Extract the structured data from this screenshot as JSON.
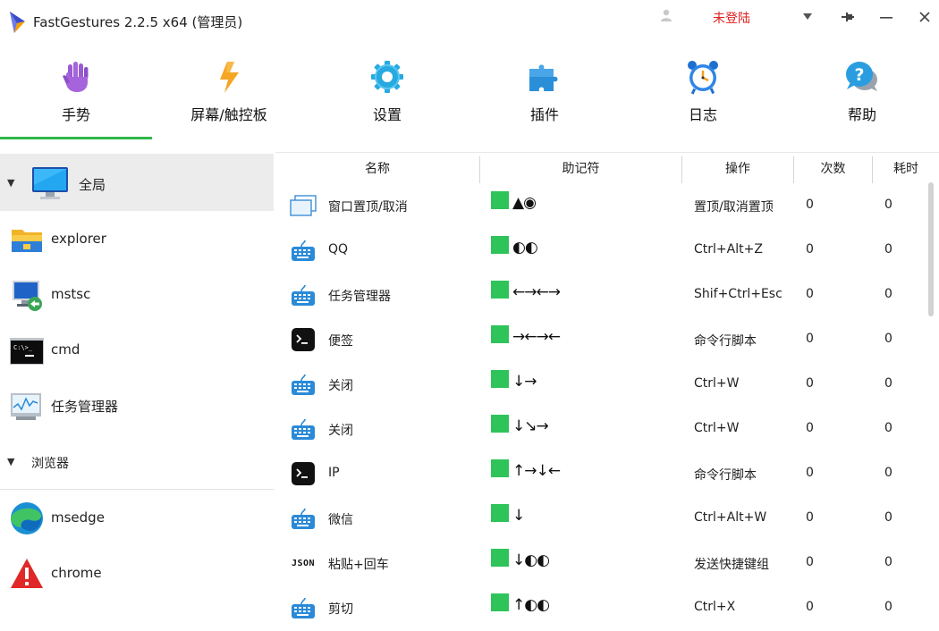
{
  "window": {
    "title": "FastGestures 2.2.5 x64 (管理员)",
    "login_status": "未登陆"
  },
  "toolbar": {
    "items": [
      {
        "label": "手势",
        "icon": "hand-icon"
      },
      {
        "label": "屏幕/触控板",
        "icon": "lightning-icon"
      },
      {
        "label": "设置",
        "icon": "gear-icon"
      },
      {
        "label": "插件",
        "icon": "puzzle-icon"
      },
      {
        "label": "日志",
        "icon": "alarm-clock-icon"
      },
      {
        "label": "帮助",
        "icon": "help-icon"
      }
    ],
    "active_index": 0
  },
  "sidebar": {
    "global": {
      "label": "全局",
      "icon": "monitor-icon"
    },
    "apps": [
      {
        "name": "explorer",
        "icon": "folder-icon"
      },
      {
        "name": "mstsc",
        "icon": "remote-desktop-icon"
      },
      {
        "name": "cmd",
        "icon": "terminal-icon"
      },
      {
        "name": "任务管理器",
        "icon": "task-manager-icon"
      }
    ],
    "browser_group": {
      "label": "浏览器"
    },
    "browser_apps": [
      {
        "name": "msedge",
        "icon": "edge-icon"
      },
      {
        "name": "chrome",
        "icon": "warning-icon"
      }
    ]
  },
  "table": {
    "columns": [
      "名称",
      "助记符",
      "操作",
      "次数",
      "耗时"
    ],
    "rows": [
      {
        "icon": "window-icon",
        "name": "窗口置顶/取消",
        "mnemonic": "▲◉",
        "action": "置顶/取消置顶",
        "count": "0",
        "time": "0"
      },
      {
        "icon": "keyboard-icon",
        "name": "QQ",
        "mnemonic": "◐◐",
        "action": "Ctrl+Alt+Z",
        "count": "0",
        "time": "0"
      },
      {
        "icon": "keyboard-icon",
        "name": "任务管理器",
        "mnemonic": "←→←→",
        "action": "Shif+Ctrl+Esc",
        "count": "0",
        "time": "0"
      },
      {
        "icon": "terminal-icon",
        "name": "便签",
        "mnemonic": "→←→←",
        "action": "命令行脚本",
        "count": "0",
        "time": "0"
      },
      {
        "icon": "keyboard-icon",
        "name": "关闭",
        "mnemonic": "↓→",
        "action": "Ctrl+W",
        "count": "0",
        "time": "0"
      },
      {
        "icon": "keyboard-icon",
        "name": "关闭",
        "mnemonic": "↓↘→",
        "action": "Ctrl+W",
        "count": "0",
        "time": "0"
      },
      {
        "icon": "terminal-icon",
        "name": "IP",
        "mnemonic": "↑→↓←",
        "action": "命令行脚本",
        "count": "0",
        "time": "0"
      },
      {
        "icon": "keyboard-icon",
        "name": "微信",
        "mnemonic": "↓",
        "action": "Ctrl+Alt+W",
        "count": "0",
        "time": "0"
      },
      {
        "icon": "json-icon",
        "icon_text": "JSON",
        "name": "粘贴+回车",
        "mnemonic": "↓◐◐",
        "action": "发送快捷键组",
        "count": "0",
        "time": "0"
      },
      {
        "icon": "keyboard-icon",
        "name": "剪切",
        "mnemonic": "↑◐◐",
        "action": "Ctrl+X",
        "count": "0",
        "time": "0"
      }
    ]
  },
  "colors": {
    "accent": "#2eb84a",
    "gesture_square": "#2ec45a",
    "login_text": "#e02020",
    "selected_row": "#ececec"
  }
}
